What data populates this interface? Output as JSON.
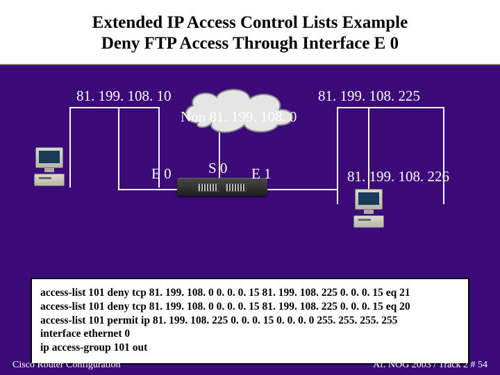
{
  "title": {
    "line1": "Extended IP Access Control Lists Example",
    "line2": "Deny FTP Access Through Interface E 0"
  },
  "labels": {
    "ip_left": "81. 199. 108. 10",
    "ip_right_top": "81. 199. 108. 225",
    "ip_right_bottom": "81. 199. 108. 226",
    "cloud": "Non 81. 199. 108. 0",
    "iface_e0": "E 0",
    "iface_s0": "S 0",
    "iface_e1": "E 1"
  },
  "acl_lines": [
    "access-list 101 deny tcp 81. 199. 108. 0 0. 0. 0. 15 81. 199. 108. 225 0. 0. 0. 15 eq 21",
    "access-list 101 deny tcp 81. 199. 108. 0 0. 0. 0. 15 81. 199. 108. 225 0. 0. 0. 15 eq 20",
    "access-list 101 permit ip 81. 199. 108. 225 0. 0. 0. 15 0. 0. 0. 0 255. 255. 255. 255",
    "interface ethernet 0",
    "ip access-group 101 out"
  ],
  "footer": {
    "left": "Cisco Router Configuration",
    "right": "Af. NOG 2003 / Track 2  # 54"
  },
  "colors": {
    "bg": "#3d0a7a",
    "text": "#ffffff"
  }
}
